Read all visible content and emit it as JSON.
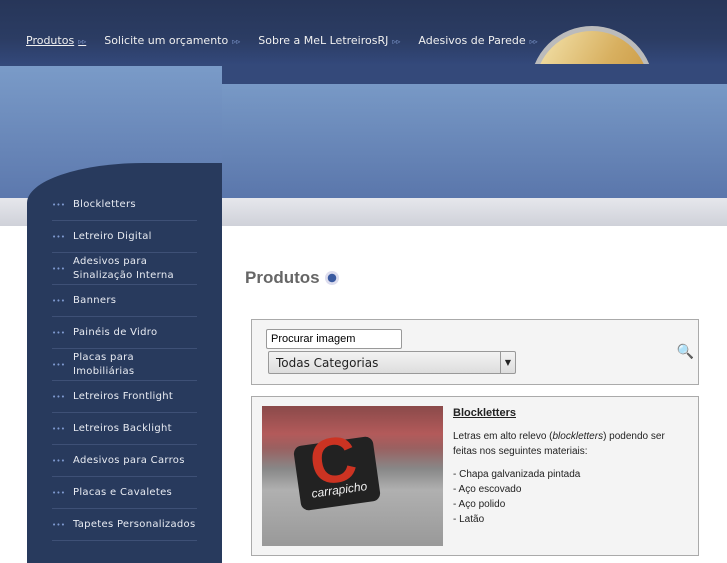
{
  "nav": [
    {
      "label": "Produtos",
      "active": true
    },
    {
      "label": "Solicite um orçamento"
    },
    {
      "label": "Sobre a MeL LetreirosRJ"
    },
    {
      "label": "Adesivos de Parede"
    }
  ],
  "sidebar": {
    "items": [
      "Blockletters",
      "Letreiro Digital",
      "Adesivos para Sinalização Interna",
      "Banners",
      "Painéis de Vidro",
      "Placas para Imobiliárias",
      "Letreiros Frontlight",
      "Letreiros Backlight",
      "Adesivos para Carros",
      "Placas e Cavaletes",
      "Tapetes Personalizados"
    ]
  },
  "page_title": "Produtos",
  "search": {
    "value": "Procurar imagem",
    "category": "Todas Categorias"
  },
  "product": {
    "title": "Blockletters",
    "desc_before": "Letras em alto relevo (",
    "desc_em": "blockletters",
    "desc_after": ") podendo ser feitas nos seguintes materiais:",
    "materials": [
      "- Chapa galvanizada pintada",
      "- Aço escovado",
      "- Aço polido",
      "- Latão"
    ],
    "image_text": "carrapicho",
    "image_letter": "C"
  }
}
